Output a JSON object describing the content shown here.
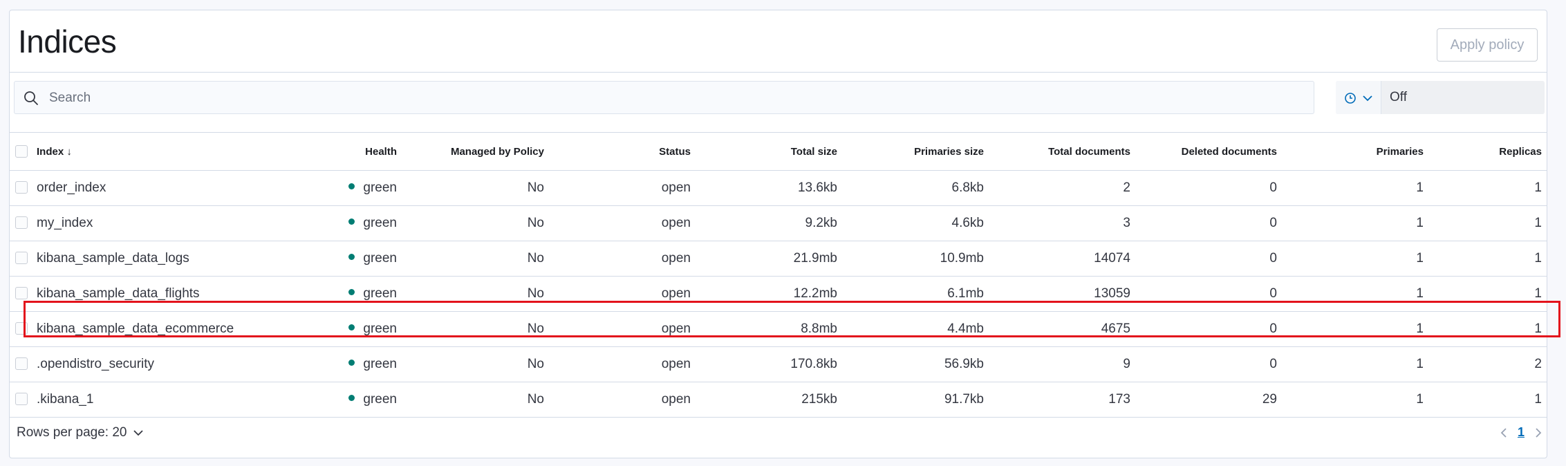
{
  "header": {
    "title": "Indices",
    "apply_label": "Apply policy"
  },
  "search": {
    "placeholder": "Search"
  },
  "refresh": {
    "value": "Off"
  },
  "columns": {
    "index": "Index",
    "health": "Health",
    "managed": "Managed by Policy",
    "status": "Status",
    "total_size": "Total size",
    "primaries_size": "Primaries size",
    "total_docs": "Total documents",
    "deleted_docs": "Deleted documents",
    "primaries": "Primaries",
    "replicas": "Replicas"
  },
  "rows": [
    {
      "index": "order_index",
      "health": "green",
      "managed": "No",
      "status": "open",
      "total_size": "13.6kb",
      "primaries_size": "6.8kb",
      "total_docs": "2",
      "deleted_docs": "0",
      "primaries": "1",
      "replicas": "1"
    },
    {
      "index": "my_index",
      "health": "green",
      "managed": "No",
      "status": "open",
      "total_size": "9.2kb",
      "primaries_size": "4.6kb",
      "total_docs": "3",
      "deleted_docs": "0",
      "primaries": "1",
      "replicas": "1"
    },
    {
      "index": "kibana_sample_data_logs",
      "health": "green",
      "managed": "No",
      "status": "open",
      "total_size": "21.9mb",
      "primaries_size": "10.9mb",
      "total_docs": "14074",
      "deleted_docs": "0",
      "primaries": "1",
      "replicas": "1"
    },
    {
      "index": "kibana_sample_data_flights",
      "health": "green",
      "managed": "No",
      "status": "open",
      "total_size": "12.2mb",
      "primaries_size": "6.1mb",
      "total_docs": "13059",
      "deleted_docs": "0",
      "primaries": "1",
      "replicas": "1"
    },
    {
      "index": "kibana_sample_data_ecommerce",
      "health": "green",
      "managed": "No",
      "status": "open",
      "total_size": "8.8mb",
      "primaries_size": "4.4mb",
      "total_docs": "4675",
      "deleted_docs": "0",
      "primaries": "1",
      "replicas": "1"
    },
    {
      "index": ".opendistro_security",
      "health": "green",
      "managed": "No",
      "status": "open",
      "total_size": "170.8kb",
      "primaries_size": "56.9kb",
      "total_docs": "9",
      "deleted_docs": "0",
      "primaries": "1",
      "replicas": "2"
    },
    {
      "index": ".kibana_1",
      "health": "green",
      "managed": "No",
      "status": "open",
      "total_size": "215kb",
      "primaries_size": "91.7kb",
      "total_docs": "173",
      "deleted_docs": "29",
      "primaries": "1",
      "replicas": "1"
    }
  ],
  "footer": {
    "rows_per_page": "Rows per page: 20",
    "current_page": "1"
  },
  "colors": {
    "health_green": "#017d73",
    "link": "#006bb8",
    "highlight": "#e3131c"
  }
}
